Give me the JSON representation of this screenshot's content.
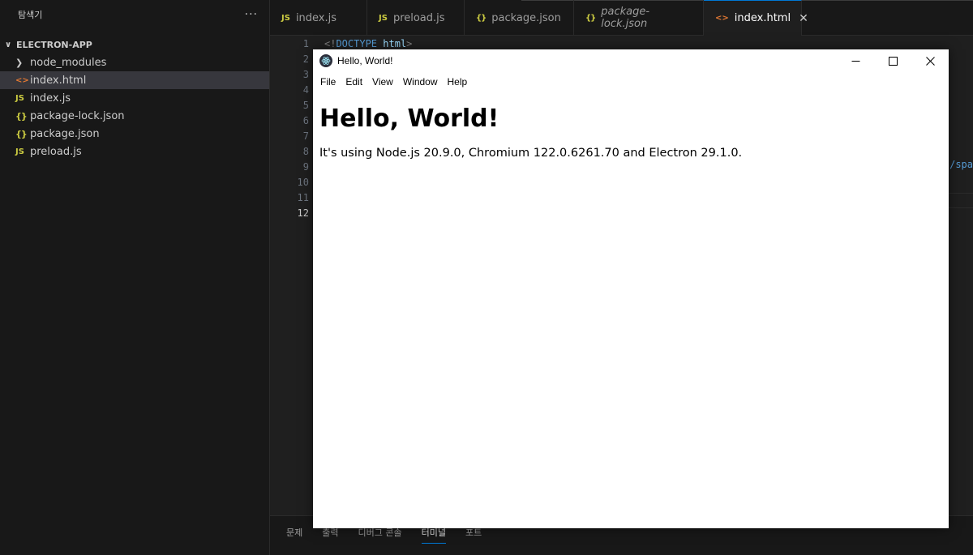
{
  "sidebar": {
    "title": "탐색기",
    "more_label": "···",
    "section_label": "ELECTRON-APP",
    "items": [
      {
        "label": "node_modules",
        "icon": "chevron-right-icon"
      },
      {
        "label": "index.html",
        "icon": "html-file-icon"
      },
      {
        "label": "index.js",
        "icon": "js-file-icon"
      },
      {
        "label": "package-lock.json",
        "icon": "json-file-icon"
      },
      {
        "label": "package.json",
        "icon": "json-file-icon"
      },
      {
        "label": "preload.js",
        "icon": "js-file-icon"
      }
    ]
  },
  "tabs": [
    {
      "label": "index.js",
      "icon": "JS"
    },
    {
      "label": "preload.js",
      "icon": "JS"
    },
    {
      "label": "package.json",
      "icon": "{}"
    },
    {
      "label": "package-lock.json",
      "icon": "{}"
    },
    {
      "label": "index.html",
      "icon": "<>"
    }
  ],
  "editor": {
    "line_numbers": [
      "1",
      "2",
      "3",
      "4",
      "5",
      "6",
      "7",
      "8",
      "9",
      "10",
      "11",
      "12"
    ],
    "line1": {
      "open": "<!",
      "keyword": "DOCTYPE",
      "tag": "html",
      "close": ">"
    },
    "right_fragment": "/spa"
  },
  "panel": {
    "tabs": [
      "문제",
      "출력",
      "디버그 콘솔",
      "터미널",
      "포트"
    ]
  },
  "app": {
    "title": "Hello, World!",
    "menu": [
      "File",
      "Edit",
      "View",
      "Window",
      "Help"
    ],
    "heading": "Hello, World!",
    "paragraph": "It's using Node.js 20.9.0, Chromium 122.0.6261.70 and Electron 29.1.0."
  },
  "colors": {
    "accent": "#0078d4",
    "js_icon": "#cbcb41",
    "html_icon": "#e37933"
  }
}
